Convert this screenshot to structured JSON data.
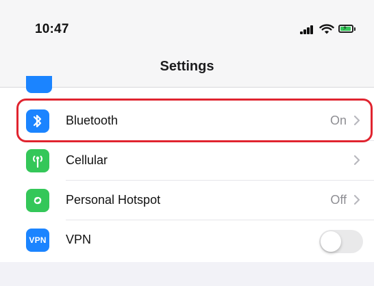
{
  "status_bar": {
    "time": "10:47",
    "icons": [
      "cellular-signal-icon",
      "wifi-icon",
      "battery-charging-icon"
    ]
  },
  "nav": {
    "title": "Settings"
  },
  "rows": [
    {
      "label": "Bluetooth",
      "value": "On",
      "icon": "bluetooth-icon",
      "icon_color": "#1b84ff",
      "highlighted": true
    },
    {
      "label": "Cellular",
      "value": "",
      "icon": "cellular-antenna-icon",
      "icon_color": "#34c759"
    },
    {
      "label": "Personal Hotspot",
      "value": "Off",
      "icon": "hotspot-icon",
      "icon_color": "#34c759"
    },
    {
      "label": "VPN",
      "icon": "vpn-icon",
      "icon_text": "VPN",
      "icon_color": "#1b84ff",
      "toggle_on": false
    }
  ],
  "colors": {
    "highlight": "#e0242f",
    "value_text": "#8e8e93",
    "toggle_off": "#e9e9ea"
  }
}
